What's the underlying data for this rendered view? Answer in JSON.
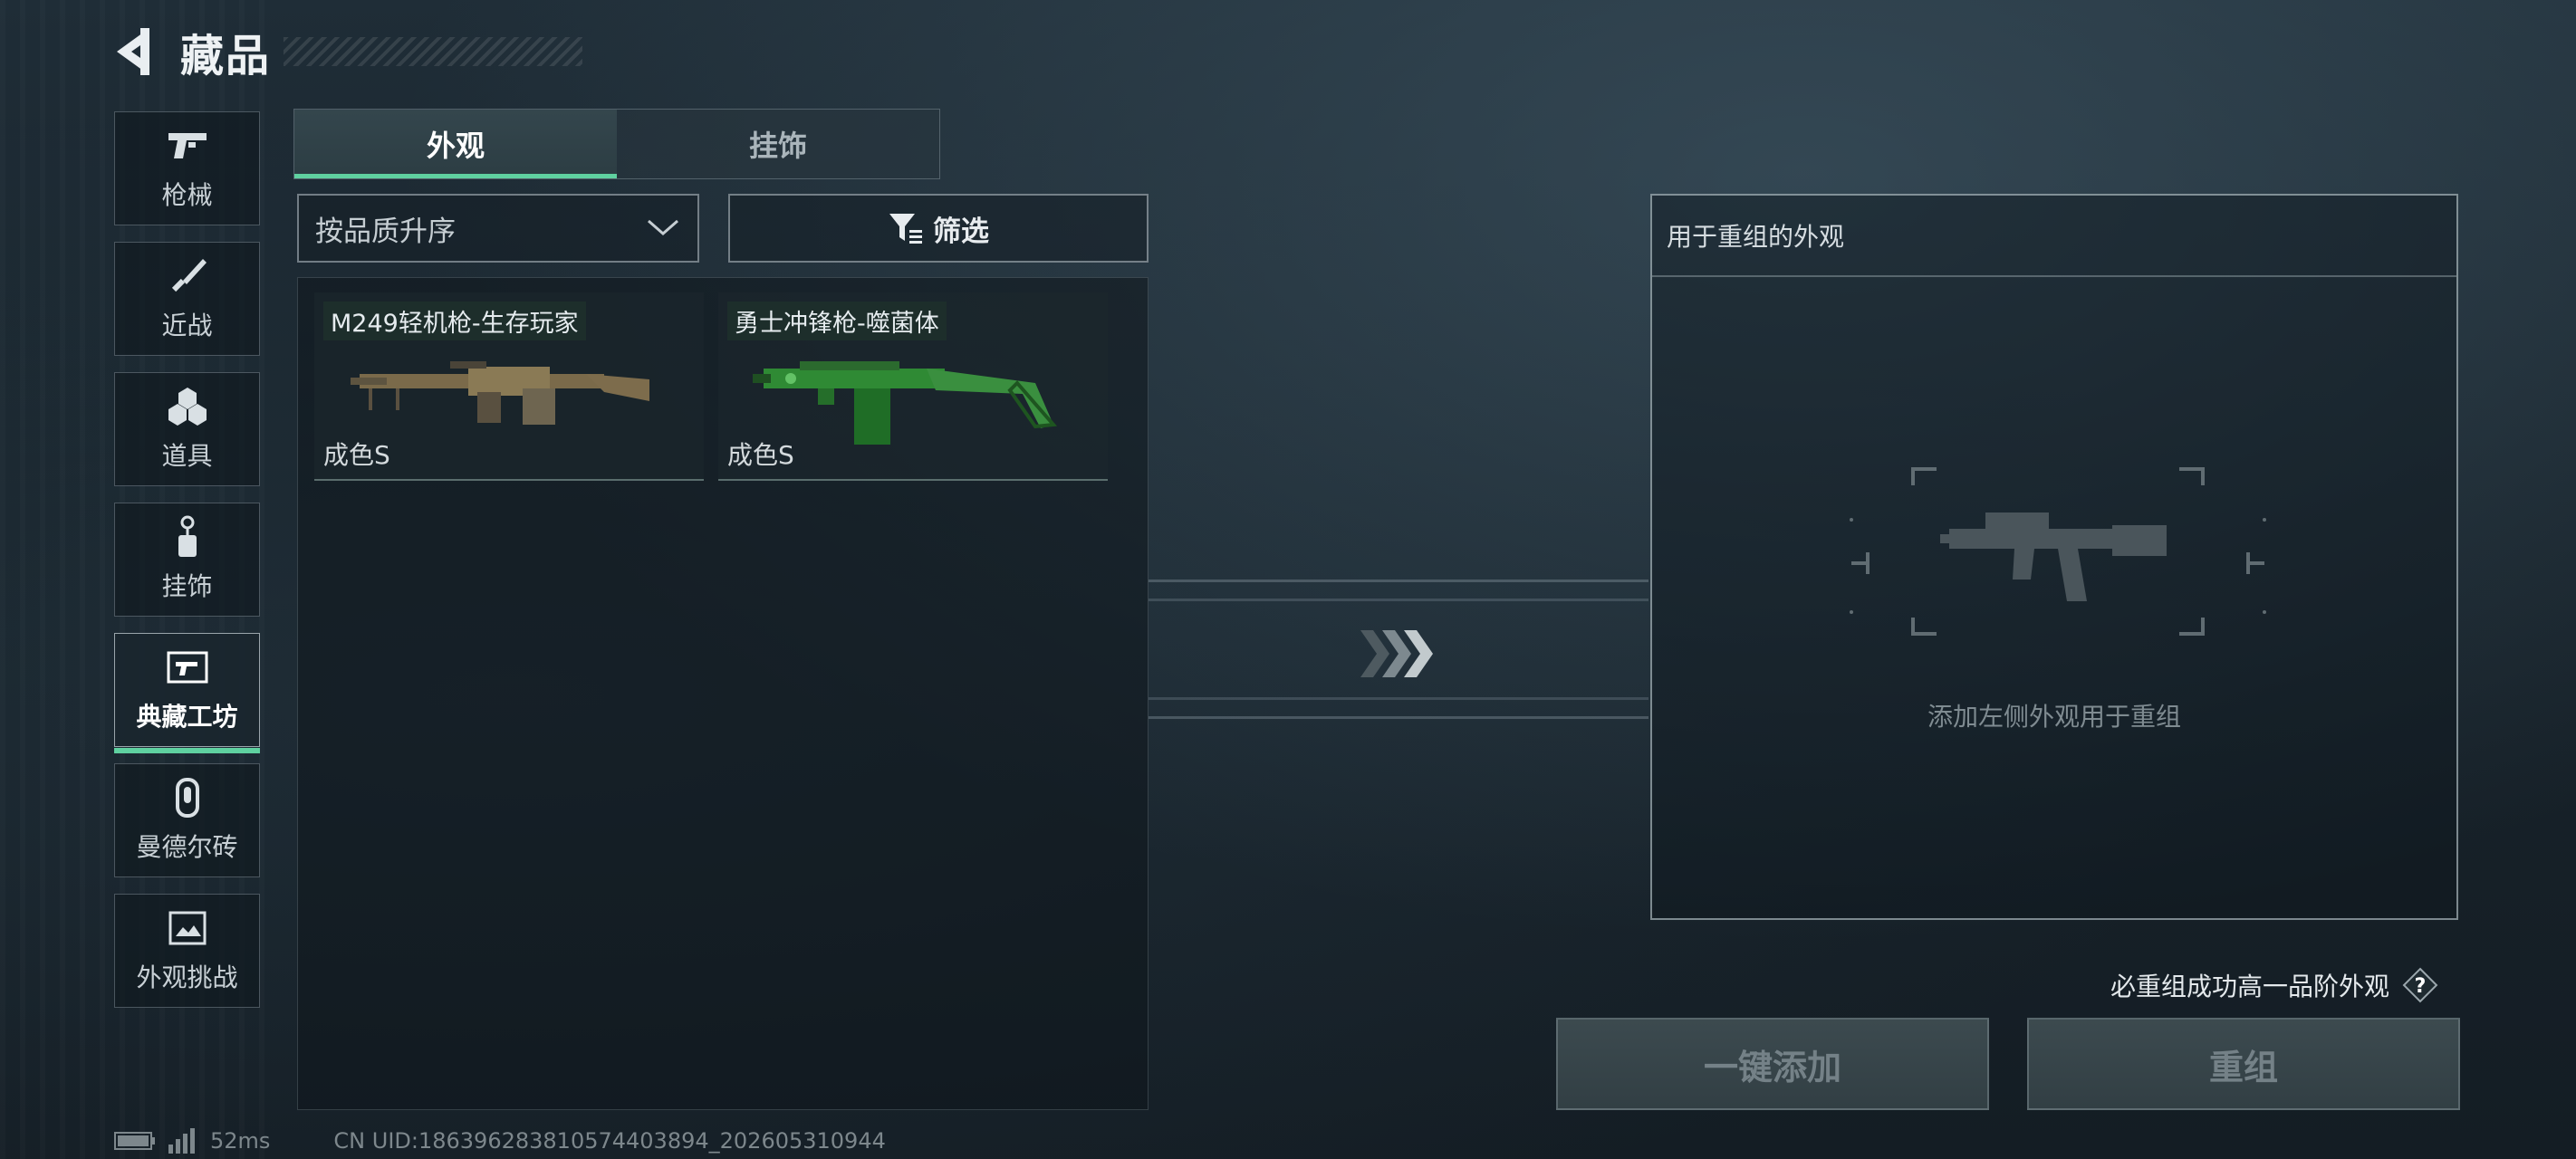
{
  "header": {
    "title": "藏品",
    "back_icon": "back-arrow-icon"
  },
  "sidebar": {
    "items": [
      {
        "label": "枪械",
        "icon": "pistol-icon",
        "active": false
      },
      {
        "label": "近战",
        "icon": "knife-icon",
        "active": false
      },
      {
        "label": "道具",
        "icon": "grenades-icon",
        "active": false
      },
      {
        "label": "挂饰",
        "icon": "charm-icon",
        "active": false
      },
      {
        "label": "典藏工坊",
        "icon": "workshop-frame-icon",
        "active": true
      },
      {
        "label": "曼德尔砖",
        "icon": "mandel-brick-icon",
        "active": false
      },
      {
        "label": "外观挑战",
        "icon": "challenge-image-icon",
        "active": false
      }
    ]
  },
  "tabs": [
    {
      "label": "外观",
      "active": true
    },
    {
      "label": "挂饰",
      "active": false
    }
  ],
  "sort": {
    "value": "按品质升序"
  },
  "filter": {
    "label": "筛选"
  },
  "items": [
    {
      "name": "M249轻机枪-生存玩家",
      "grade": "成色S"
    },
    {
      "name": "勇士冲锋枪-噬菌体",
      "grade": "成色S"
    }
  ],
  "recombine": {
    "header": "用于重组的外观",
    "hint": "添加左侧外观用于重组"
  },
  "guarantee": {
    "text": "必重组成功高一品阶外观",
    "help": "?"
  },
  "buttons": {
    "add_all": "一键添加",
    "recombine": "重组"
  },
  "status": {
    "ping": "52ms",
    "uid": "CN UID:18639628381057440389​4_202605310944"
  },
  "colors": {
    "accent": "#5fd1a0",
    "panel_border": "#c3d2d7"
  }
}
